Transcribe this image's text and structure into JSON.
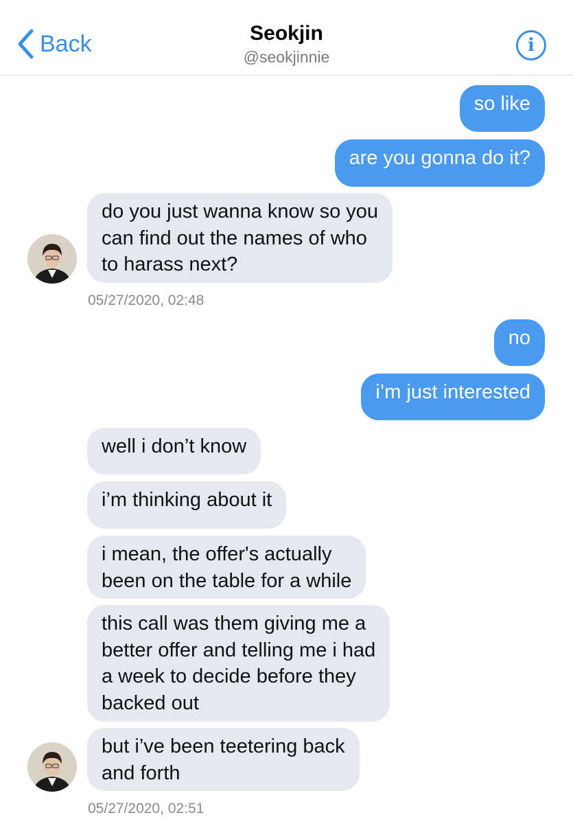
{
  "header": {
    "back_label": "Back",
    "contact_name": "Seokjin",
    "contact_handle": "@seokjinnie",
    "info_label": "i"
  },
  "colors": {
    "accent": "#3a8ee6",
    "outgoing_bubble": "#4a9bef",
    "incoming_bubble": "#e6e8ef"
  },
  "messages": [
    {
      "from": "me",
      "text": "so like"
    },
    {
      "from": "me",
      "text": "are you gonna do it?"
    },
    {
      "from": "them",
      "lines": [
        "do you just wanna know so you",
        "can find out the names of who",
        "to harass next?"
      ]
    },
    {
      "from": "me",
      "text": "no"
    },
    {
      "from": "me",
      "text": "i’m just interested"
    },
    {
      "from": "them",
      "text": "well i don’t know"
    },
    {
      "from": "them",
      "text": "i’m thinking about it"
    },
    {
      "from": "them",
      "lines": [
        "i mean, the offer's actually",
        "been on the table for a while"
      ]
    },
    {
      "from": "them",
      "lines": [
        "this call was them giving me a",
        "better offer and telling me i had",
        "a week to decide before they",
        "backed out"
      ]
    },
    {
      "from": "them",
      "lines": [
        "but i’ve been teetering back",
        "and forth"
      ]
    }
  ],
  "timestamps": [
    "05/27/2020, 02:48",
    "05/27/2020, 02:51"
  ]
}
